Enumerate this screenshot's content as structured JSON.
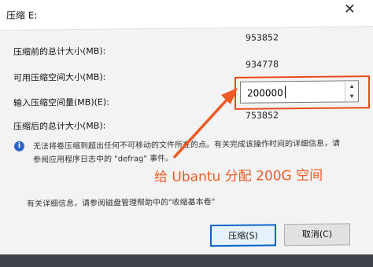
{
  "window": {
    "title": "压缩 E:",
    "close_glyph": "✕"
  },
  "fields": {
    "total_before_label": "压缩前的总计大小(MB):",
    "total_before_value": "953852",
    "available_label": "可用压缩空间大小(MB):",
    "available_value": "934778",
    "shrink_amount_label": "输入压缩空间量(MB)(E):",
    "shrink_amount_value": "200000",
    "total_after_label": "压缩后的总计大小(MB):",
    "total_after_value": "753852"
  },
  "info": {
    "icon": "info-icon",
    "line1": "无法将卷压缩到超出任何不可移动的文件所在的点。有关完成该操作时间的详细信息，请",
    "line2": "参阅应用程序日志中的 \"defrag\" 事件。",
    "more_info": "有关详细信息，请参阅磁盘管理帮助中的\"收缩基本卷\""
  },
  "annotation": {
    "text": "给 Ubantu 分配 200G 空间",
    "color": "#ee5a22"
  },
  "buttons": {
    "shrink": "压缩(S)",
    "cancel": "取消(C)"
  },
  "colors": {
    "accent": "#0a64c8",
    "highlight": "#e84b1a"
  }
}
